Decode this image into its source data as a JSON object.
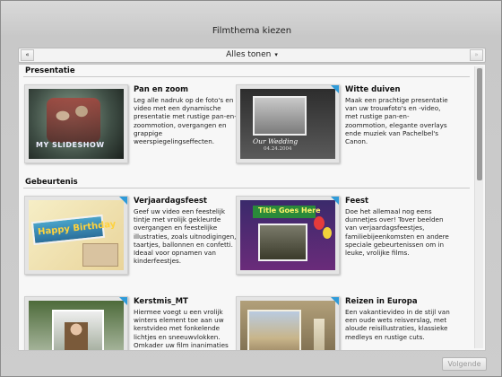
{
  "window": {
    "title": "Filmthema kiezen"
  },
  "toolbar": {
    "prev_icon": "double-chevron-left-icon",
    "next_icon": "double-chevron-right-icon",
    "filter_value": "Alles tonen",
    "filter_caret": "▾"
  },
  "sections": [
    {
      "label": "Presentatie",
      "items": [
        {
          "title": "Pan en zoom",
          "desc": "Leg alle nadruk op de foto's en video met een dynamische presentatie met rustige pan-en-zoommotion, overgangen en grappige weerspiegelingseffecten.",
          "thumb_caption": "MY SLIDESHOW"
        },
        {
          "title": "Witte duiven",
          "desc": "Maak een prachtige presentatie van uw trouwfoto's en -video, met rustige pan-en-zoommotion, elegante overlays ende muziek van Pachelbel's Canon.",
          "thumb_caption": "Our Wedding",
          "thumb_caption2": "04.24.2004"
        }
      ]
    },
    {
      "label": "Gebeurtenis",
      "items": [
        {
          "title": "Verjaardagsfeest",
          "desc": "Geef uw video een feestelijk tintje met vrolijk gekleurde overgangen en feestelijke illustraties, zoals uitnodigingen, taartjes, ballonnen en confetti. Ideaal voor opnamen van kinderfeestjes.",
          "thumb_caption": "Happy Birthday"
        },
        {
          "title": "Feest",
          "desc": "Doe het allemaal nog eens dunnetjes over! Tover beelden van verjaardagsfeestjes, familiebijeenkomsten en andere speciale gebeurtenissen om in leuke, vrolijke films.",
          "thumb_caption": "Title Goes Here"
        },
        {
          "title": "Kerstmis_MT",
          "desc": "Hiermee voegt u een vrolijk winters element toe aan uw kerstvideo met fonkelende lichtjes en sneeuwvlokken. Omkader uw film inanimaties"
        },
        {
          "title": "Reizen in Europa",
          "desc": "Een vakantievideo in de stijl van een oude wets reisverslag, met aloude reisillustraties, klassieke medleys en rustige cuts."
        }
      ]
    }
  ],
  "footer": {
    "next_label": "Volgende"
  },
  "colors": {
    "accent_corner": "#2f9bd9"
  }
}
